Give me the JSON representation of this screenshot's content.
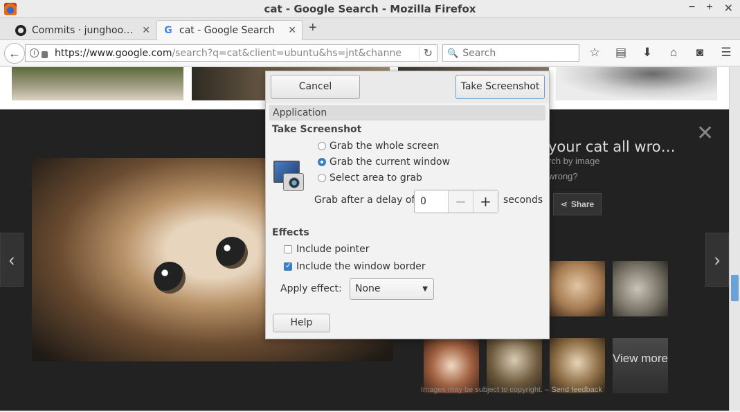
{
  "window": {
    "title": "cat - Google Search - Mozilla Firefox",
    "controls": [
      "−",
      "+",
      "✕"
    ]
  },
  "tabs": [
    {
      "label": "Commits · junghoo…",
      "icon": "github-icon",
      "close": "✕"
    },
    {
      "label": "cat - Google Search",
      "icon": "google-icon",
      "close": "✕",
      "active": true
    }
  ],
  "new_tab": "+",
  "navbar": {
    "url_host": "https://www.google.com",
    "url_path": "/search?q=cat&client=ubuntu&hs=jnt&channe",
    "search_placeholder": "Search",
    "icons": [
      "star-icon",
      "reading-list-icon",
      "download-icon",
      "home-icon",
      "pocket-icon",
      "menu-icon"
    ]
  },
  "viewer": {
    "title": "your cat all wro…",
    "sub1": "rch by image",
    "sub2": "wrong?",
    "share": "Share",
    "view_more": "View more",
    "copyright_text": "Images may be subject to copyright.",
    "feedback": "Send feedback"
  },
  "dialog": {
    "cancel": "Cancel",
    "take_screenshot_btn": "Take Screenshot",
    "section": "Application",
    "take_heading": "Take Screenshot",
    "options": [
      {
        "label": "Grab the whole screen",
        "selected": false
      },
      {
        "label": "Grab the current window",
        "selected": true
      },
      {
        "label": "Select area to grab",
        "selected": false
      }
    ],
    "delay_label": "Grab after a delay of",
    "delay_value": "0",
    "seconds": "seconds",
    "effects_heading": "Effects",
    "include_pointer": {
      "label": "Include pointer",
      "checked": false
    },
    "include_border": {
      "label": "Include the window border",
      "checked": true
    },
    "apply_label": "Apply effect:",
    "apply_value": "None",
    "help": "Help"
  },
  "colors": {
    "accent": "#3b7fc4",
    "overlay_bg": "#222222"
  }
}
